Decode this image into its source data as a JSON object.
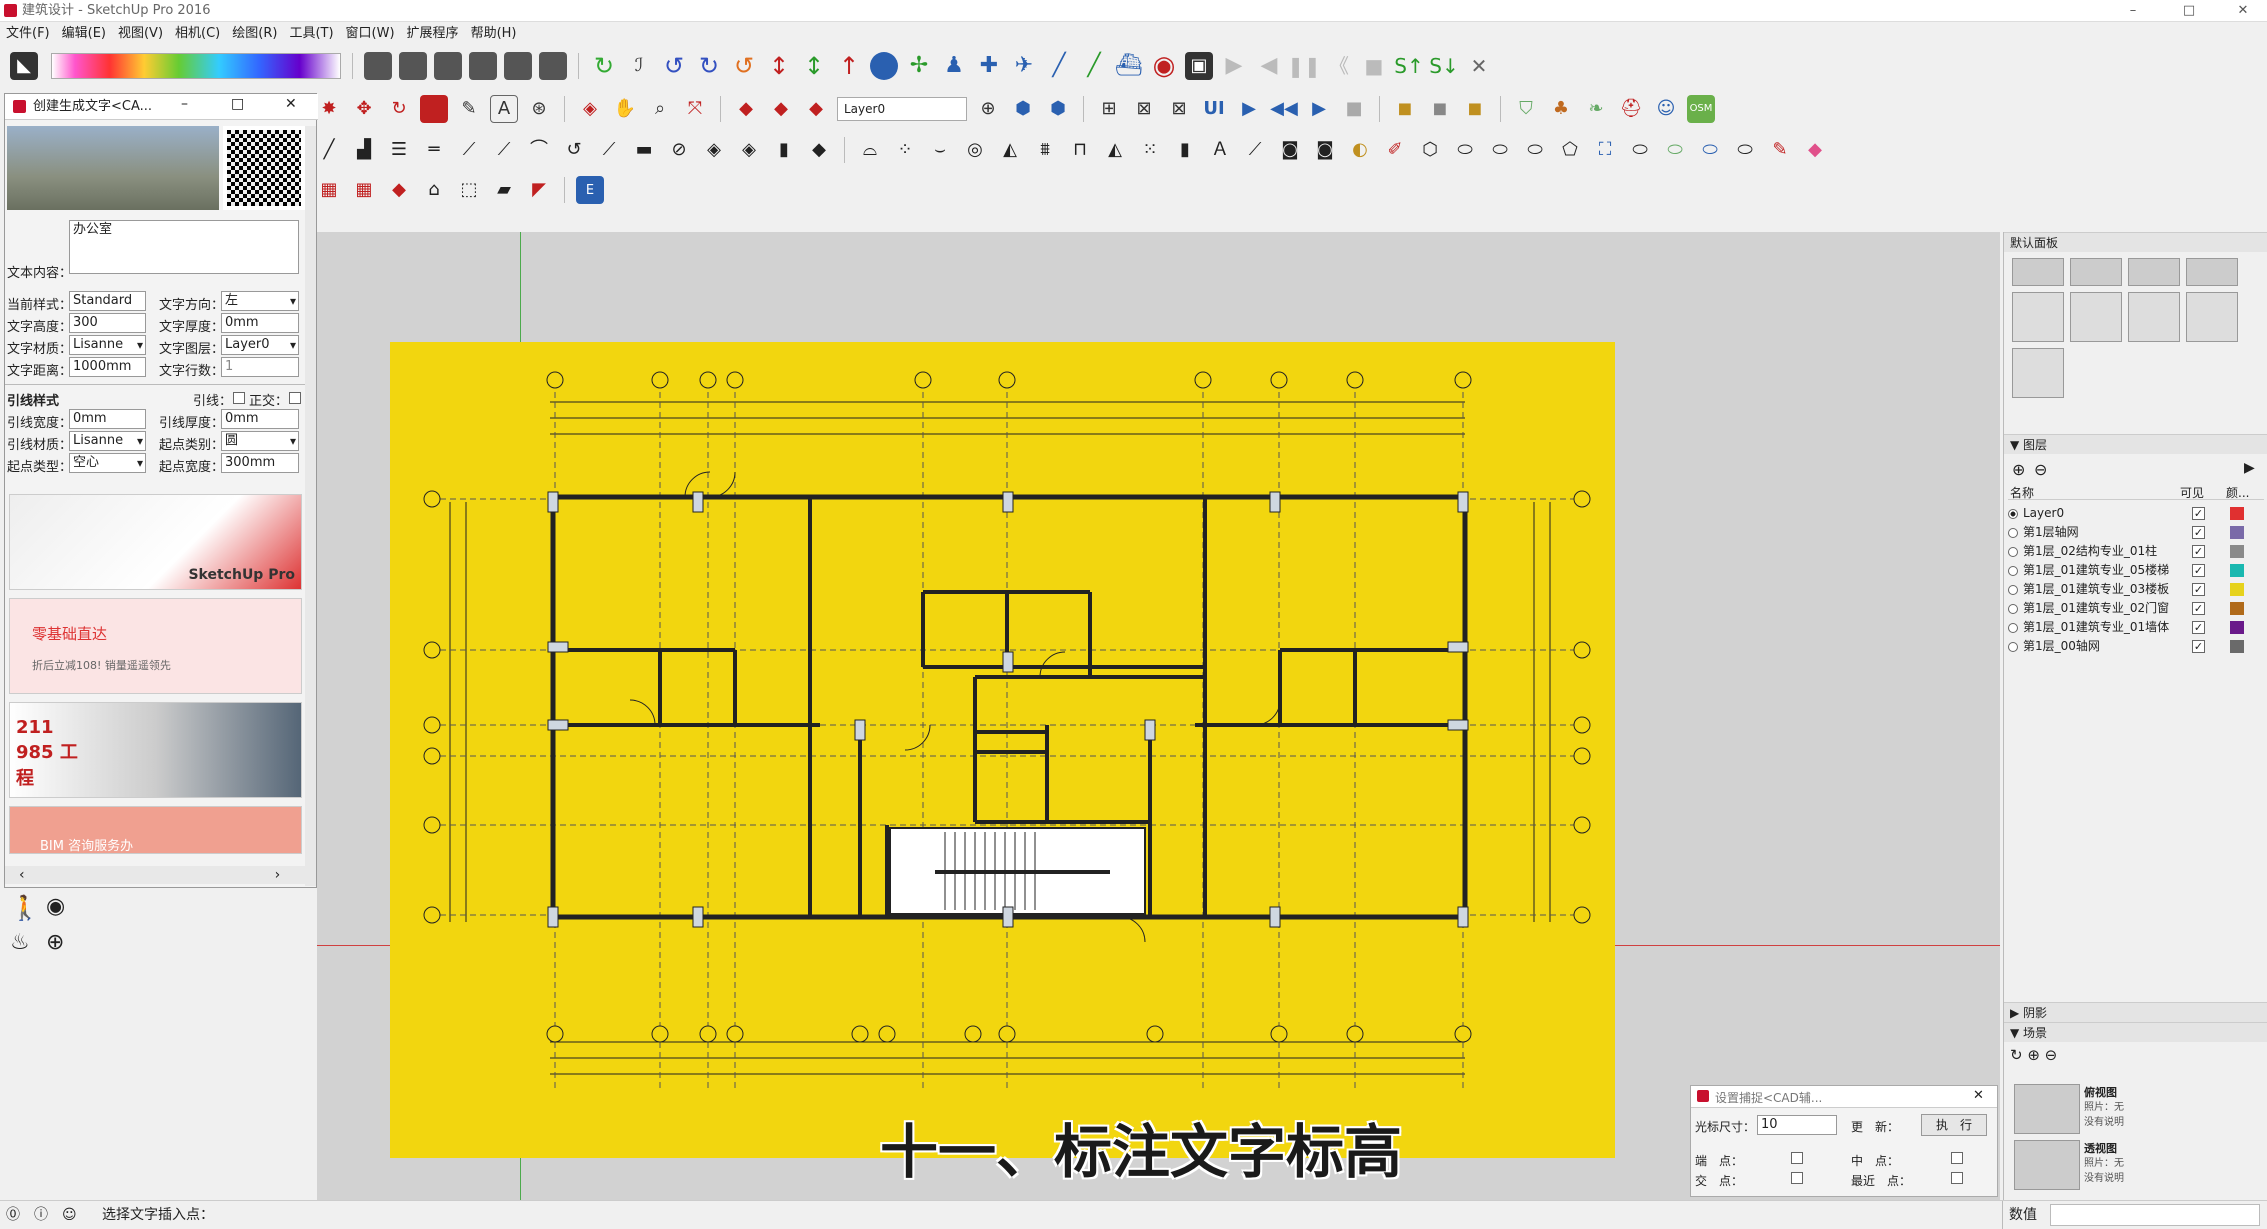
{
  "window": {
    "title": "建筑设计 - SketchUp Pro 2016",
    "minimize": "–",
    "maximize": "□",
    "close": "✕"
  },
  "menu": [
    "文件(F)",
    "编辑(E)",
    "视图(V)",
    "相机(C)",
    "绘图(R)",
    "工具(T)",
    "窗口(W)",
    "扩展程序",
    "帮助(H)"
  ],
  "toolbar": {
    "layer_value": "Layer0",
    "style_scale": "1 2 3 4 5 6 7 8 9 10 11 12"
  },
  "text_panel": {
    "title": "创建生成文字<CA...",
    "content_label": "文本内容：",
    "content_value": "办公室",
    "style_label": "当前样式：",
    "style_value": "Standard",
    "dir_label": "文字方向：",
    "dir_value": "左",
    "height_label": "文字高度：",
    "height_value": "300",
    "thick_label": "文字厚度：",
    "thick_value": "0mm",
    "mat_label": "文字材质：",
    "mat_value": "Lisanne",
    "layer_label": "文字图层：",
    "layer_value": "Layer0",
    "dist_label": "文字距离：",
    "dist_value": "1000mm",
    "rows_label": "文字行数：",
    "rows_value": "1",
    "leader_title": "引线样式",
    "leader_label": "引线：",
    "ortho_label": "正交：",
    "lw_label": "引线宽度：",
    "lw_value": "0mm",
    "lt_label": "引线厚度：",
    "lt_value": "0mm",
    "lm_label": "引线材质：",
    "lm_value": "Lisanne",
    "st_label": "起点类别：",
    "st_value": "圆",
    "sf_label": "起点类型：",
    "sf_value": "空心",
    "sw_label": "起点宽度：",
    "sw_value": "300mm",
    "ads": [
      "SketchUp Pro",
      "零基础直达",
      "折后立减108! 销量遥遥领先",
      "211 985 工程",
      "BIM 咨询服务办"
    ]
  },
  "right_panel": {
    "title": "默认面板",
    "layers_title": "图层",
    "col_name": "名称",
    "col_visible": "可见",
    "col_color": "颜...",
    "layers": [
      {
        "name": "Layer0",
        "color": "#e03030",
        "active": true
      },
      {
        "name": "第1层轴网",
        "color": "#7a6aa8",
        "active": false
      },
      {
        "name": "第1层_02结构专业_01柱",
        "color": "#8a8a8a",
        "active": false
      },
      {
        "name": "第1层_01建筑专业_05楼梯",
        "color": "#1ab8b0",
        "active": false
      },
      {
        "name": "第1层_01建筑专业_03楼板",
        "color": "#e6d21c",
        "active": false
      },
      {
        "name": "第1层_01建筑专业_02门窗",
        "color": "#b06a1a",
        "active": false
      },
      {
        "name": "第1层_01建筑专业_01墙体",
        "color": "#6a1a8a",
        "active": false
      },
      {
        "name": "第1层_00轴网",
        "color": "#6a6a6a",
        "active": false
      }
    ],
    "shadow_title": "阴影",
    "scenes_title": "场景",
    "scene1_name": "俯视图",
    "scene1_desc": "照片：无\n没有说明",
    "scene2_name": "透视图",
    "scene2_desc": "照片：无\n没有说明"
  },
  "snap_dialog": {
    "title": "设置捕捉<CAD辅...",
    "cursor_label": "光标尺寸：",
    "cursor_value": "10",
    "update_label": "更　新：",
    "run_label": "执　行",
    "endpoint_label": "端　点：",
    "midpoint_label": "中　点：",
    "intersect_label": "交　点：",
    "nearest_label": "最近　点："
  },
  "subtitle": "十一、标注文字标高",
  "status": {
    "hint": "选择文字插入点：",
    "value_label": "数值"
  }
}
